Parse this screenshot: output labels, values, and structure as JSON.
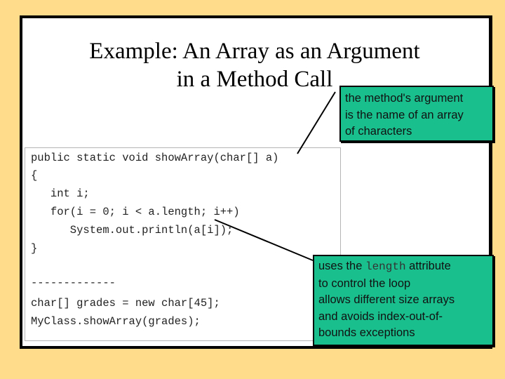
{
  "slide": {
    "title_lines": [
      "Example: An Array as an Argument",
      "in a Method Call"
    ],
    "background_color": "#FFDC8C",
    "callout_color": "#19C08E"
  },
  "code": {
    "lines": [
      "public static void showArray(char[] a)",
      "{",
      "   int i;",
      "   for(i = 0; i < a.length; i++)",
      "      System.out.println(a[i]);",
      "}",
      "",
      "-------------",
      "char[] grades = new char[45];",
      "MyClass.showArray(grades);"
    ]
  },
  "callouts": {
    "argument": {
      "lines": [
        "the method's argument",
        "is the name of an array",
        "of characters"
      ]
    },
    "length": {
      "prefix": "uses the ",
      "code_word": "length",
      "suffix": " attribute",
      "lines": [
        "to control the loop",
        "allows different size arrays",
        "and avoids index-out-of-",
        "bounds exceptions"
      ]
    }
  }
}
